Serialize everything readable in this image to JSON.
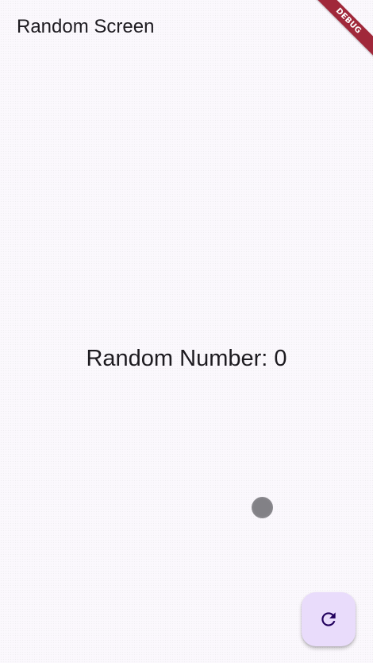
{
  "app_bar": {
    "title": "Random Screen"
  },
  "debug_banner": {
    "label": "DEBUG",
    "color": "#a0283a"
  },
  "main": {
    "random_text": "Random Number: 0"
  },
  "fab": {
    "icon": "refresh-icon",
    "background": "#e9dcfb",
    "icon_color": "#21005d"
  }
}
